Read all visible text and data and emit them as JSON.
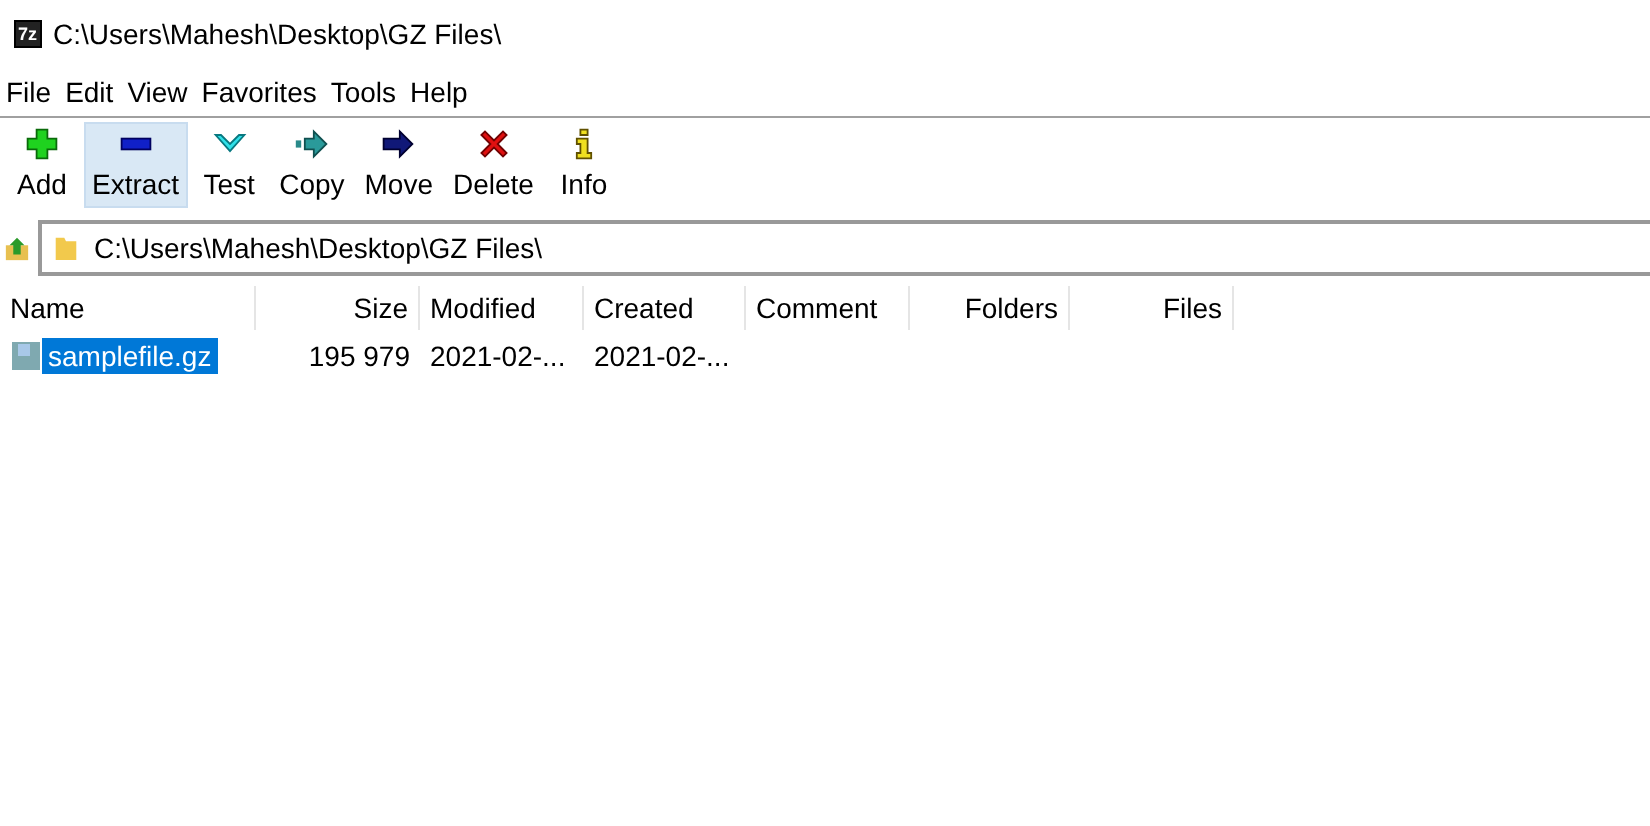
{
  "window": {
    "icon_text": "7z",
    "title": "C:\\Users\\Mahesh\\Desktop\\GZ Files\\"
  },
  "menu": [
    "File",
    "Edit",
    "View",
    "Favorites",
    "Tools",
    "Help"
  ],
  "toolbar": [
    {
      "kind": "add",
      "label": "Add",
      "selected": false
    },
    {
      "kind": "extract",
      "label": "Extract",
      "selected": true
    },
    {
      "kind": "test",
      "label": "Test",
      "selected": false
    },
    {
      "kind": "copy",
      "label": "Copy",
      "selected": false
    },
    {
      "kind": "move",
      "label": "Move",
      "selected": false
    },
    {
      "kind": "delete",
      "label": "Delete",
      "selected": false
    },
    {
      "kind": "info",
      "label": "Info",
      "selected": false
    }
  ],
  "address": {
    "path": "C:\\Users\\Mahesh\\Desktop\\GZ Files\\"
  },
  "table": {
    "columns": [
      {
        "label": "Name"
      },
      {
        "label": "Size"
      },
      {
        "label": "Modified"
      },
      {
        "label": "Created"
      },
      {
        "label": "Comment"
      },
      {
        "label": "Folders"
      },
      {
        "label": "Files"
      }
    ],
    "rows": [
      {
        "name": "samplefile.gz",
        "size": "195 979",
        "modified": "2021-02-...",
        "created": "2021-02-...",
        "selected": true
      }
    ]
  }
}
